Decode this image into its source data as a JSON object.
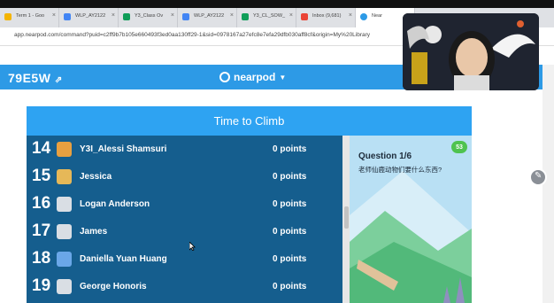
{
  "browser": {
    "tabs": [
      {
        "label": "Term 1 - Goo",
        "icon": "google-drive-icon",
        "color": "#f4b400"
      },
      {
        "label": "WLP_AY2122",
        "icon": "docs-icon",
        "color": "#4285f4"
      },
      {
        "label": "Y3_Class Ov",
        "icon": "sheets-icon",
        "color": "#0f9d58"
      },
      {
        "label": "WLP_AY2122",
        "icon": "docs-icon",
        "color": "#4285f4"
      },
      {
        "label": "Y3_CL_SOW_",
        "icon": "sheets-icon",
        "color": "#0f9d58"
      },
      {
        "label": "Inbox (9,681)",
        "icon": "gmail-icon",
        "color": "#ea4335"
      },
      {
        "label": "Near",
        "icon": "nearpod-icon",
        "color": "#2d9ae6"
      }
    ],
    "url": "app.nearpod.com/command?puid=c2ff9b7b105e660493f3ed0aa130ff29-1&sid=0978167a27efc8e7efa29dfb030aff8cf&origin=My%20Library"
  },
  "nearpod": {
    "code": "79E5W",
    "brand": "nearpod"
  },
  "activity": {
    "title": "Time to Climb",
    "leaderboard": [
      {
        "rank": "14",
        "name": "Y3I_Alessi Shamsuri",
        "points": "0 points",
        "avatar": "fox-avatar-icon",
        "avatar_color": "#e8a040"
      },
      {
        "rank": "15",
        "name": "Jessica",
        "points": "0 points",
        "avatar": "monkey-avatar-icon",
        "avatar_color": "#e6b858"
      },
      {
        "rank": "16",
        "name": "Logan Anderson",
        "points": "0 points",
        "avatar": "penguin-avatar-icon",
        "avatar_color": "#d9dee4"
      },
      {
        "rank": "17",
        "name": "James",
        "points": "0 points",
        "avatar": "penguin-avatar-icon",
        "avatar_color": "#d9dee4"
      },
      {
        "rank": "18",
        "name": "Daniella Yuan Huang",
        "points": "0 points",
        "avatar": "bird-avatar-icon",
        "avatar_color": "#6aa7e8"
      },
      {
        "rank": "19",
        "name": "George Honoris",
        "points": "0 points",
        "avatar": "penguin-avatar-icon",
        "avatar_color": "#d9dee4"
      }
    ],
    "question": {
      "title": "Question 1/6",
      "text": "老师仙鹿动物们要什么东西?",
      "timer": "53"
    }
  },
  "colors": {
    "header_blue": "#2d9ae6",
    "leaderboard_bg": "#155e8e",
    "title_bar": "#2ea3f2"
  }
}
